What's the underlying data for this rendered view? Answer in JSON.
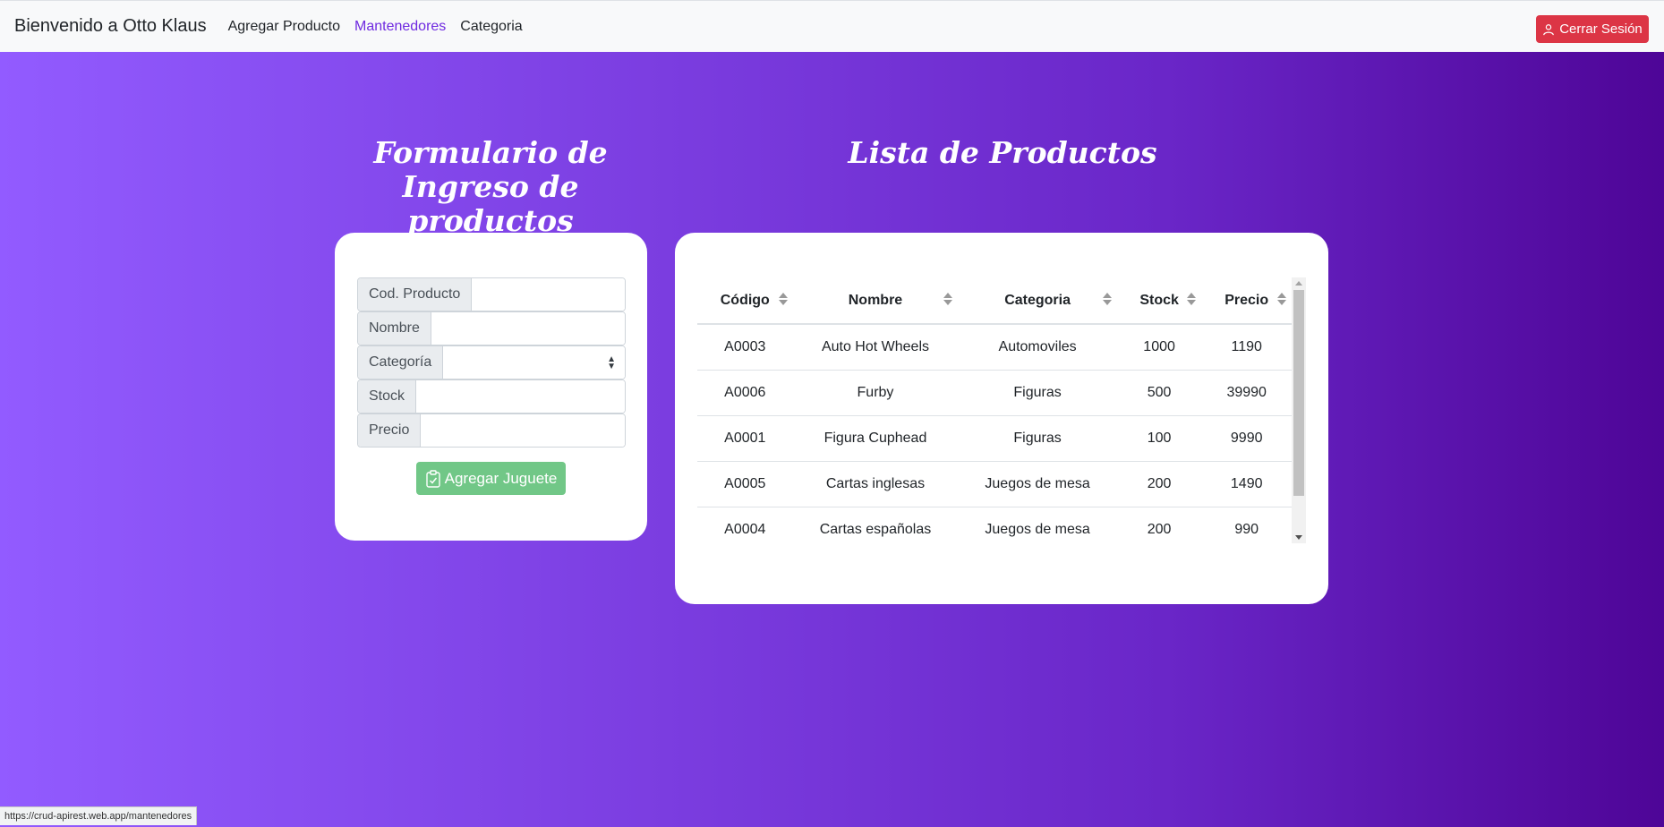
{
  "navbar": {
    "brand": "Bienvenido a Otto Klaus",
    "links": [
      "Agregar Producto",
      "Mantenedores",
      "Categoria"
    ],
    "active_link": "Mantenedores",
    "logout_label": "Cerrar Sesión",
    "logout_color": "#dc3545"
  },
  "form": {
    "title": "Formulario de Ingreso de productos",
    "fields": {
      "codigo": {
        "label": "Cod. Producto",
        "value": ""
      },
      "nombre": {
        "label": "Nombre",
        "value": ""
      },
      "categoria": {
        "label": "Categoría",
        "value": ""
      },
      "stock": {
        "label": "Stock",
        "value": ""
      },
      "precio": {
        "label": "Precio",
        "value": ""
      }
    },
    "submit_label": "Agregar Juguete",
    "submit_icon": "clipboard-check-icon",
    "submit_color": "#71c787"
  },
  "list": {
    "title": "Lista de Productos",
    "columns": [
      "Código",
      "Nombre",
      "Categoria",
      "Stock",
      "Precio"
    ],
    "rows": [
      [
        "A0003",
        "Auto Hot Wheels",
        "Automoviles",
        "1000",
        "1190"
      ],
      [
        "A0006",
        "Furby",
        "Figuras",
        "500",
        "39990"
      ],
      [
        "A0001",
        "Figura Cuphead",
        "Figuras",
        "100",
        "9990"
      ],
      [
        "A0005",
        "Cartas inglesas",
        "Juegos de mesa",
        "200",
        "1490"
      ],
      [
        "A0004",
        "Cartas españolas",
        "Juegos de mesa",
        "200",
        "990"
      ]
    ]
  },
  "statusbar": {
    "url": "https://crud-apirest.web.app/mantenedores"
  },
  "colors": {
    "gradient_start": "#925bff",
    "gradient_end": "#4e0597"
  }
}
